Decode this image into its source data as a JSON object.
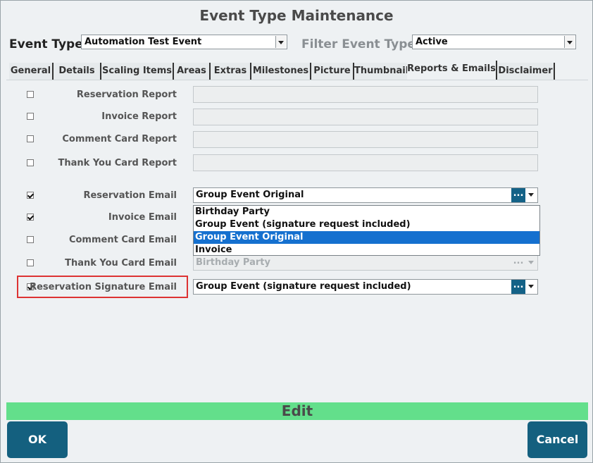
{
  "window": {
    "title": "Event Type Maintenance"
  },
  "header": {
    "event_type_label": "Event Type",
    "event_type_value": "Automation Test Event",
    "filter_label": "Filter Event Types",
    "filter_value": "Active"
  },
  "tabs": [
    {
      "label": "General"
    },
    {
      "label": "Details"
    },
    {
      "label": "Scaling Items"
    },
    {
      "label": "Areas"
    },
    {
      "label": "Extras"
    },
    {
      "label": "Milestones"
    },
    {
      "label": "Picture"
    },
    {
      "label": "Thumbnail"
    },
    {
      "label": "Reports & Emails",
      "active": true
    },
    {
      "label": "Disclaimer"
    }
  ],
  "reports": [
    {
      "label": "Reservation Report",
      "checked": false
    },
    {
      "label": "Invoice Report",
      "checked": false
    },
    {
      "label": "Comment Card Report",
      "checked": false
    },
    {
      "label": "Thank You Card Report",
      "checked": false
    }
  ],
  "emails": [
    {
      "label": "Reservation Email",
      "checked": true,
      "value": "Group Event Original"
    },
    {
      "label": "Invoice Email",
      "checked": true,
      "value": ""
    },
    {
      "label": "Comment Card Email",
      "checked": false,
      "value": ""
    },
    {
      "label": "Thank You Card Email",
      "checked": false,
      "value": "Birthday Party"
    },
    {
      "label": "Reservation Signature Email",
      "checked": true,
      "value": "Group Event (signature request included)"
    }
  ],
  "dropdown": {
    "options": [
      "Birthday Party",
      "Group Event (signature request included)",
      "Group Event Original",
      "Invoice"
    ],
    "selected": "Group Event Original"
  },
  "combo_button_label": "...",
  "edit_bar_label": "Edit",
  "buttons": {
    "ok": "OK",
    "cancel": "Cancel"
  },
  "colors": {
    "accent": "#14607f",
    "edit_bar": "#63df8b",
    "highlight": "#dd3333",
    "selected": "#1570cf"
  }
}
